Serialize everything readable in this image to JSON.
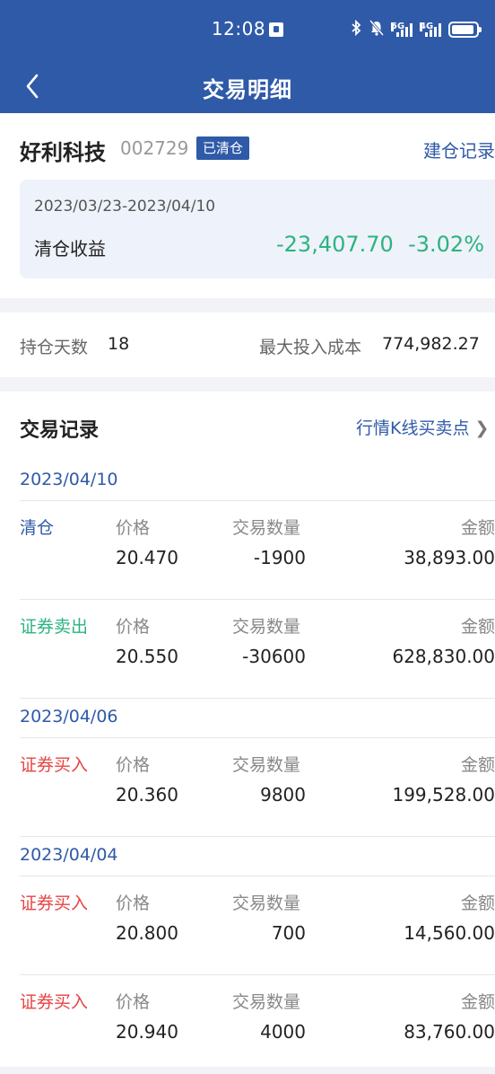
{
  "status_bar": {
    "time": "12:08",
    "network1": "5G",
    "network2": "4G"
  },
  "nav": {
    "title": "交易明细"
  },
  "stock": {
    "name": "好利科技",
    "code": "002729",
    "badge": "已清仓",
    "link": "建仓记录",
    "period": "2023/03/23-2023/04/10",
    "profit_label": "清仓收益",
    "profit_value": "-23,407.70",
    "profit_pct": "-3.02%"
  },
  "summary": {
    "hold_days_label": "持仓天数",
    "hold_days": "18",
    "max_cost_label": "最大投入成本",
    "max_cost": "774,982.27"
  },
  "records": {
    "title": "交易记录",
    "kline_link": "行情K线买卖点",
    "labels": {
      "price": "价格",
      "qty": "交易数量",
      "amount": "金额"
    },
    "dates": [
      "2023/04/10",
      "2023/04/06",
      "2023/04/04"
    ],
    "trades": [
      {
        "type": "清仓",
        "price": "20.470",
        "qty": "-1900",
        "amount": "38,893.00"
      },
      {
        "type": "证券卖出",
        "price": "20.550",
        "qty": "-30600",
        "amount": "628,830.00"
      },
      {
        "type": "证券买入",
        "price": "20.360",
        "qty": "9800",
        "amount": "199,528.00"
      },
      {
        "type": "证券买入",
        "price": "20.800",
        "qty": "700",
        "amount": "14,560.00"
      },
      {
        "type": "证券买入",
        "price": "20.940",
        "qty": "4000",
        "amount": "83,760.00"
      }
    ]
  },
  "colors": {
    "brand": "#2f5aa8",
    "gain_green": "#2cb37f",
    "buy_red": "#e84343"
  }
}
